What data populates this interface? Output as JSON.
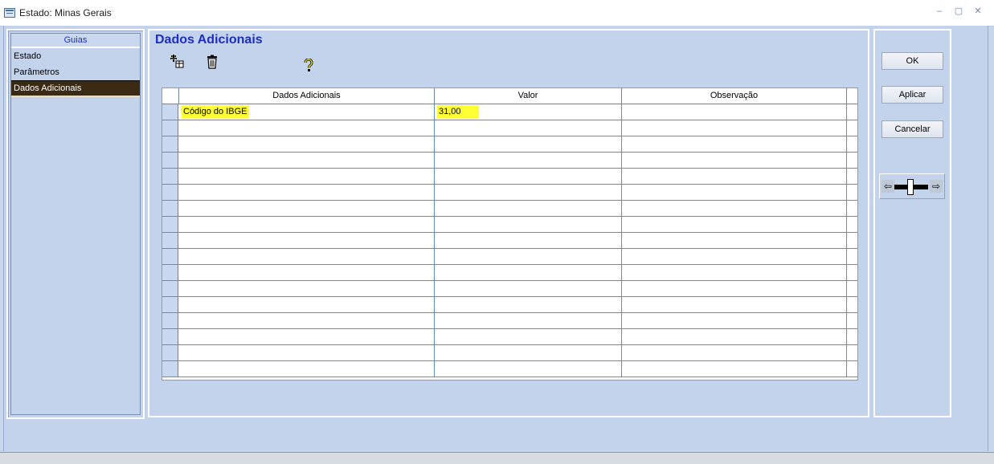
{
  "window": {
    "title": "Estado: Minas Gerais",
    "controls": [
      "–",
      "▢",
      "✕"
    ]
  },
  "sidebar": {
    "header": "Guias",
    "items": [
      {
        "label": "Estado"
      },
      {
        "label": "Parâmetros"
      },
      {
        "label": "Dados Adicionais"
      }
    ],
    "active_index": 2
  },
  "main": {
    "title": "Dados Adicionais",
    "toolbar": {
      "icons": [
        "add-row-icon",
        "trash-icon",
        "help-icon"
      ]
    },
    "grid": {
      "columns": [
        "Dados Adicionais",
        "Valor",
        "Observação"
      ],
      "rows": [
        [
          "Código do IBGE",
          "31,00",
          ""
        ],
        [
          "",
          "",
          ""
        ],
        [
          "",
          "",
          ""
        ],
        [
          "",
          "",
          ""
        ],
        [
          "",
          "",
          ""
        ],
        [
          "",
          "",
          ""
        ],
        [
          "",
          "",
          ""
        ],
        [
          "",
          "",
          ""
        ],
        [
          "",
          "",
          ""
        ],
        [
          "",
          "",
          ""
        ],
        [
          "",
          "",
          ""
        ],
        [
          "",
          "",
          ""
        ],
        [
          "",
          "",
          ""
        ],
        [
          "",
          "",
          ""
        ],
        [
          "",
          "",
          ""
        ],
        [
          "",
          "",
          ""
        ],
        [
          "",
          "",
          ""
        ]
      ]
    }
  },
  "actions": {
    "ok": "OK",
    "apply": "Aplicar",
    "cancel": "Cancelar"
  },
  "colors": {
    "title_blue": "#1b2fc6",
    "highlight": "#ffff33",
    "active_tab": "#3b2a14",
    "background": "#c4d3ec"
  }
}
